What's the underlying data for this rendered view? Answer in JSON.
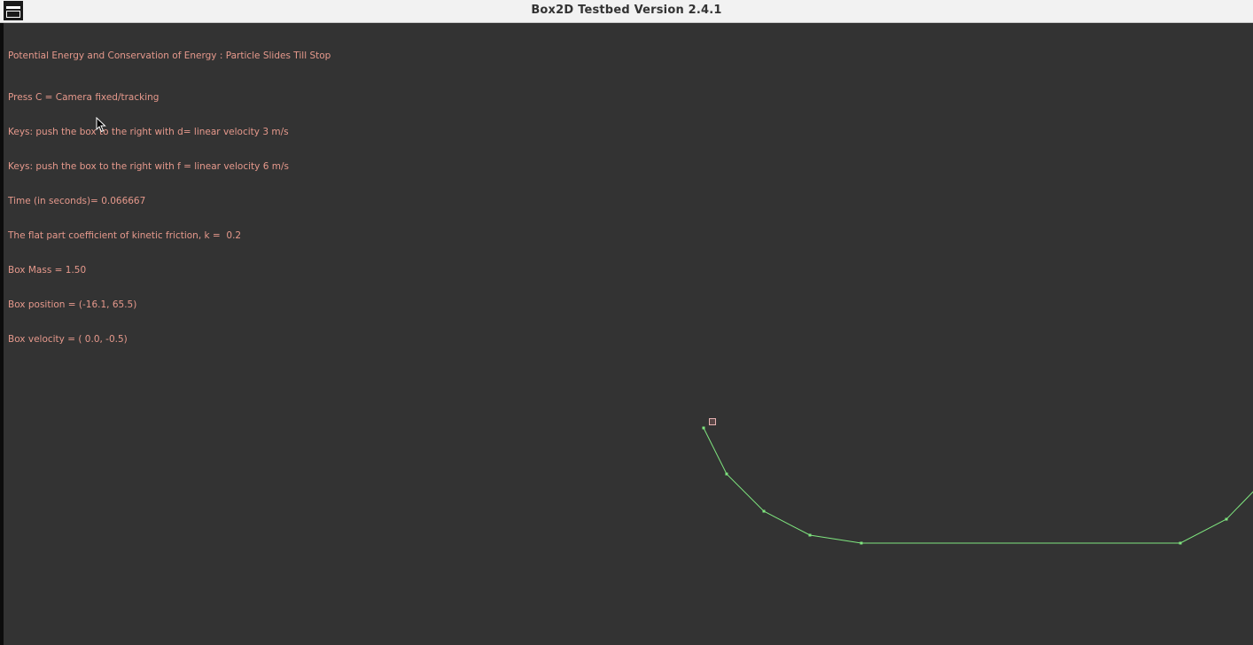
{
  "window": {
    "title": "Box2D Testbed Version 2.4.1"
  },
  "hud": {
    "heading": "Potential Energy and Conservation of Energy : Particle Slides Till Stop",
    "lines": [
      "Press C = Camera fixed/tracking",
      "Keys: push the box to the right with d= linear velocity 3 m/s",
      "Keys: push the box to the right with f = linear velocity 6 m/s",
      "Time (in seconds)= 0.066667",
      "The flat part coefficient of kinetic friction, k =  0.2",
      "Box Mass = 1.50",
      "Box position = (-16.1, 65.5)",
      "Box velocity = ( 0.0, -0.5)"
    ]
  },
  "colors": {
    "background": "#333333",
    "text": "#e6998c",
    "ground": "#7fe67f",
    "box_outline": "#e6b2b2",
    "box_fill": "#805959"
  },
  "icons": {
    "app": "window-app-icon",
    "cursor": "mouse-pointer-icon"
  }
}
